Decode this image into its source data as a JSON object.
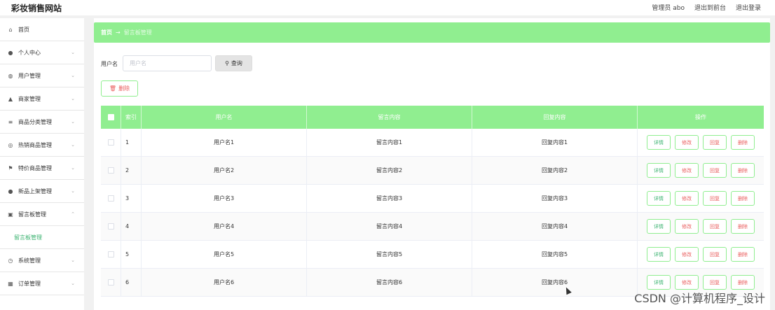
{
  "app": {
    "title": "彩妆销售网站"
  },
  "topnav": {
    "admin": "管理员 abo",
    "front": "退出到前台",
    "logout": "退出登录"
  },
  "sidebar": {
    "items": [
      {
        "label": "首页",
        "icon": "home-icon",
        "glyph": "⌂"
      },
      {
        "label": "个人中心",
        "icon": "user-icon",
        "glyph": "●"
      },
      {
        "label": "用户管理",
        "icon": "globe-icon",
        "glyph": "◍"
      },
      {
        "label": "商家管理",
        "icon": "thumb-icon",
        "glyph": "▲"
      },
      {
        "label": "商品分类管理",
        "icon": "list-icon",
        "glyph": "≡"
      },
      {
        "label": "热销商品管理",
        "icon": "compass-icon",
        "glyph": "◎"
      },
      {
        "label": "特价商品管理",
        "icon": "flag-icon",
        "glyph": "⚑"
      },
      {
        "label": "新品上架管理",
        "icon": "location-icon",
        "glyph": "●"
      },
      {
        "label": "留言板管理",
        "icon": "clipboard-icon",
        "glyph": "▣"
      },
      {
        "label": "系统管理",
        "icon": "clock-icon",
        "glyph": "◷"
      },
      {
        "label": "订单管理",
        "icon": "grid-icon",
        "glyph": "▦"
      }
    ],
    "sub_item": "留言板管理"
  },
  "breadcrumb": {
    "home": "首页",
    "arrow": "→",
    "current": "留言板管理"
  },
  "search": {
    "label": "用户名",
    "placeholder": "用户名",
    "button": "查询"
  },
  "toolbar": {
    "delete": "删除"
  },
  "table": {
    "headers": {
      "index": "索引",
      "user": "用户名",
      "message": "留言内容",
      "reply": "回复内容",
      "ops": "操作"
    },
    "ops": {
      "detail": "详情",
      "edit": "修改",
      "reply": "回复",
      "delete": "删除"
    },
    "rows": [
      {
        "idx": "1",
        "user": "用户名1",
        "message": "留言内容1",
        "reply": "回复内容1"
      },
      {
        "idx": "2",
        "user": "用户名2",
        "message": "留言内容2",
        "reply": "回复内容2"
      },
      {
        "idx": "3",
        "user": "用户名3",
        "message": "留言内容3",
        "reply": "回复内容3"
      },
      {
        "idx": "4",
        "user": "用户名4",
        "message": "留言内容4",
        "reply": "回复内容4"
      },
      {
        "idx": "5",
        "user": "用户名5",
        "message": "留言内容5",
        "reply": "回复内容5"
      },
      {
        "idx": "6",
        "user": "用户名6",
        "message": "留言内容6",
        "reply": "回复内容6"
      }
    ]
  },
  "watermark": "CSDN @计算机程序_设计",
  "colors": {
    "accent": "#90ee90",
    "danger": "#e95c5c",
    "link": "#3cb371"
  }
}
